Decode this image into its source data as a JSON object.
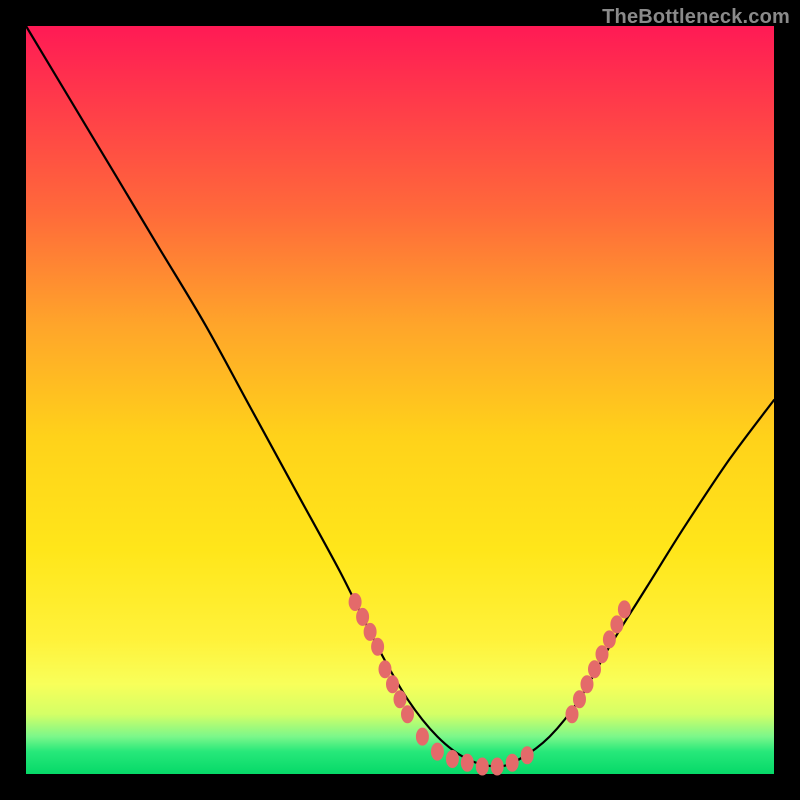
{
  "watermark": "TheBottleneck.com",
  "chart_data": {
    "type": "line",
    "title": "",
    "xlabel": "",
    "ylabel": "",
    "xlim": [
      0,
      100
    ],
    "ylim": [
      0,
      100
    ],
    "grid": false,
    "legend": false,
    "background_gradient_stops": [
      {
        "pct": 0,
        "color": "#ff1a55"
      },
      {
        "pct": 10,
        "color": "#ff3a4a"
      },
      {
        "pct": 25,
        "color": "#ff6a3a"
      },
      {
        "pct": 40,
        "color": "#ffa52a"
      },
      {
        "pct": 55,
        "color": "#ffd21a"
      },
      {
        "pct": 70,
        "color": "#ffe61a"
      },
      {
        "pct": 82,
        "color": "#fff23a"
      },
      {
        "pct": 88,
        "color": "#f8ff5a"
      },
      {
        "pct": 92,
        "color": "#d4ff66"
      },
      {
        "pct": 95,
        "color": "#7bf78a"
      },
      {
        "pct": 97,
        "color": "#27e87a"
      },
      {
        "pct": 100,
        "color": "#06d968"
      }
    ],
    "series": [
      {
        "name": "bottleneck-curve",
        "x": [
          0,
          6,
          12,
          18,
          24,
          30,
          36,
          42,
          47,
          51,
          55,
          59,
          63,
          66,
          70,
          74,
          78,
          83,
          88,
          94,
          100
        ],
        "y": [
          100,
          90,
          80,
          70,
          60,
          49,
          38,
          27,
          17,
          10,
          5,
          2,
          1,
          2,
          5,
          10,
          17,
          25,
          33,
          42,
          50
        ]
      }
    ],
    "markers": {
      "name": "highlight-dots",
      "color": "#e46a6a",
      "points": [
        {
          "x": 44,
          "y": 23
        },
        {
          "x": 45,
          "y": 21
        },
        {
          "x": 46,
          "y": 19
        },
        {
          "x": 47,
          "y": 17
        },
        {
          "x": 48,
          "y": 14
        },
        {
          "x": 49,
          "y": 12
        },
        {
          "x": 50,
          "y": 10
        },
        {
          "x": 51,
          "y": 8
        },
        {
          "x": 53,
          "y": 5
        },
        {
          "x": 55,
          "y": 3
        },
        {
          "x": 57,
          "y": 2
        },
        {
          "x": 59,
          "y": 1.5
        },
        {
          "x": 61,
          "y": 1
        },
        {
          "x": 63,
          "y": 1
        },
        {
          "x": 65,
          "y": 1.5
        },
        {
          "x": 67,
          "y": 2.5
        },
        {
          "x": 73,
          "y": 8
        },
        {
          "x": 74,
          "y": 10
        },
        {
          "x": 75,
          "y": 12
        },
        {
          "x": 76,
          "y": 14
        },
        {
          "x": 77,
          "y": 16
        },
        {
          "x": 78,
          "y": 18
        },
        {
          "x": 79,
          "y": 20
        },
        {
          "x": 80,
          "y": 22
        }
      ]
    }
  }
}
